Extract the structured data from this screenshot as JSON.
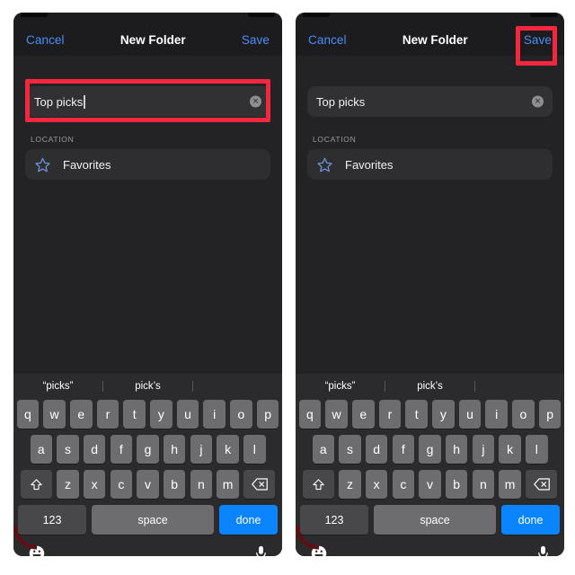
{
  "meta": {
    "accent_blue": "#4a8df8",
    "highlight_red": "#f5273f",
    "done_key_blue": "#0a84ff",
    "screen_bg": "#232325",
    "keyboard_bg": "#2b2b2d"
  },
  "panels": [
    {
      "id": "left",
      "nav": {
        "cancel": "Cancel",
        "title": "New Folder",
        "save": "Save"
      },
      "field": {
        "value": "Top picks",
        "clear_glyph": "✕",
        "has_caret": true
      },
      "section": {
        "label": "LOCATION",
        "row_label": "Favorites",
        "row_icon": "star-icon"
      },
      "highlight": "text-field"
    },
    {
      "id": "right",
      "nav": {
        "cancel": "Cancel",
        "title": "New Folder",
        "save": "Save"
      },
      "field": {
        "value": "Top picks",
        "clear_glyph": "✕",
        "has_caret": false
      },
      "section": {
        "label": "LOCATION",
        "row_label": "Favorites",
        "row_icon": "star-icon"
      },
      "highlight": "save-button"
    }
  ],
  "keyboard": {
    "suggestions": [
      "“picks”",
      "pick’s",
      ""
    ],
    "row1": [
      "q",
      "w",
      "e",
      "r",
      "t",
      "y",
      "u",
      "i",
      "o",
      "p"
    ],
    "row2": [
      "a",
      "s",
      "d",
      "f",
      "g",
      "h",
      "j",
      "k",
      "l"
    ],
    "row3": [
      "z",
      "x",
      "c",
      "v",
      "b",
      "n",
      "m"
    ],
    "shift_icon": "shift-icon",
    "backspace_icon": "backspace-icon",
    "numbers_key": "123",
    "space_key": "space",
    "done_key": "done",
    "emoji_icon": "emoji-icon",
    "mic_icon": "microphone-icon"
  }
}
